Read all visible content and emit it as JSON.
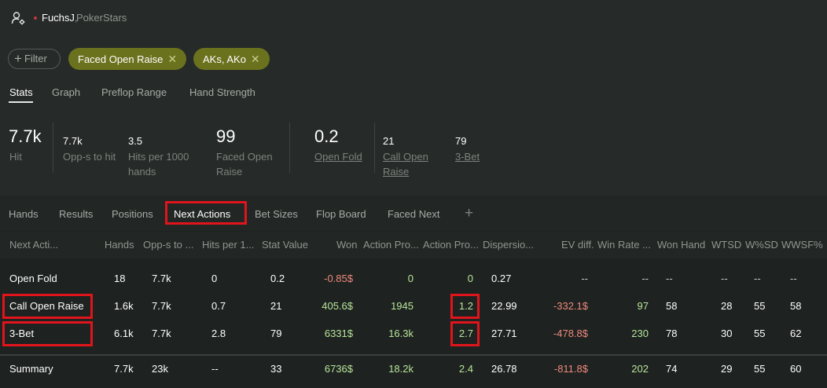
{
  "header": {
    "username": "FuchsJ",
    "comma": ",",
    "room": "PokerStars"
  },
  "filters": {
    "add_label": "Filter",
    "chips": [
      {
        "label": "Faced Open Raise"
      },
      {
        "label": "AKs, AKo"
      }
    ]
  },
  "stats_tabs": [
    "Stats",
    "Graph",
    "Preflop Range",
    "Hand Strength"
  ],
  "summary": {
    "hit_value": "7.7k",
    "hit_label": "Hit",
    "opps_value": "7.7k",
    "opps_label": "Opp-s to hit",
    "hits_per_value": "3.5",
    "hits_per_label_1": "Hits per 1000",
    "hits_per_label_2": "hands",
    "faced_value": "99",
    "faced_label_1": "Faced Open",
    "faced_label_2": "Raise",
    "openfold_value": "0.2",
    "openfold_label": "Open Fold",
    "callopen_value": "21",
    "callopen_label_1": "Call Open",
    "callopen_label_2": "Raise",
    "threebet_value": "79",
    "threebet_label": "3-Bet"
  },
  "next_tabs": [
    "Hands",
    "Results",
    "Positions",
    "Next Actions",
    "Bet Sizes",
    "Flop Board",
    "Faced Next"
  ],
  "table": {
    "columns": [
      "Next Acti...",
      "Hands",
      "Opp-s to ...",
      "Hits per 1...",
      "Stat Value",
      "Won",
      "Action Pro...",
      "Action Pro...",
      "Dispersio...",
      "EV diff.",
      "Win Rate ...",
      "Won Hand",
      "WTSD",
      "W%SD",
      "WWSF%"
    ],
    "rows": [
      {
        "name": "Open Fold",
        "hands": "18",
        "opps": "7.7k",
        "hits": "0",
        "stat": "0.2",
        "won": "-0.85$",
        "ap1": "0",
        "ap2": "0",
        "disp": "0.27",
        "ev": "--",
        "winrate": "--",
        "wonhand": "--",
        "wtsd": "--",
        "wsd": "--",
        "wwsf": "--"
      },
      {
        "name": "Call Open Raise",
        "hands": "1.6k",
        "opps": "7.7k",
        "hits": "0.7",
        "stat": "21",
        "won": "405.6$",
        "ap1": "1945",
        "ap2": "1.2",
        "disp": "22.99",
        "ev": "-332.1$",
        "winrate": "97",
        "wonhand": "58",
        "wtsd": "28",
        "wsd": "55",
        "wwsf": "58"
      },
      {
        "name": "3-Bet",
        "hands": "6.1k",
        "opps": "7.7k",
        "hits": "2.8",
        "stat": "79",
        "won": "6331$",
        "ap1": "16.3k",
        "ap2": "2.7",
        "disp": "27.71",
        "ev": "-478.8$",
        "winrate": "230",
        "wonhand": "78",
        "wtsd": "30",
        "wsd": "55",
        "wwsf": "62"
      }
    ],
    "summary": {
      "name": "Summary",
      "hands": "7.7k",
      "opps": "23k",
      "hits": "--",
      "stat": "33",
      "won": "6736$",
      "ap1": "18.2k",
      "ap2": "2.4",
      "disp": "26.78",
      "ev": "-811.8$",
      "winrate": "202",
      "wonhand": "74",
      "wtsd": "29",
      "wsd": "55",
      "wwsf": "60"
    }
  },
  "colors": {
    "accent_chip": "#6b721e",
    "positive": "#b8e59b",
    "negative": "#ee8a7d",
    "highlight_box": "#e0151b"
  }
}
